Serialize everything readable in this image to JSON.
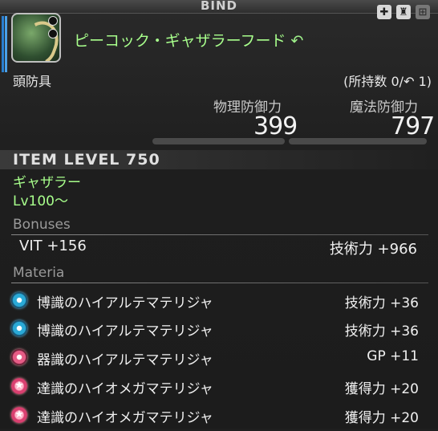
{
  "header": {
    "bind": "BIND"
  },
  "item": {
    "name": "ピーコック・ギャザラーフード",
    "category": "頭防具",
    "owned": "(所持数 0/",
    "owned_suffix": " 1)"
  },
  "stats": [
    {
      "label": "物理防御力",
      "value": "399"
    },
    {
      "label": "魔法防御力",
      "value": "797"
    }
  ],
  "item_level": "ITEM LEVEL 750",
  "class": "ギャザラー",
  "level": "Lv100～",
  "bonuses": {
    "title": "Bonuses",
    "left": "VIT +156",
    "right": "技術力 +966"
  },
  "materia": {
    "title": "Materia",
    "items": [
      {
        "name": "博識のハイアルテマテリジャ",
        "value": "技術力 +36",
        "type": "blue"
      },
      {
        "name": "博識のハイアルテマテリジャ",
        "value": "技術力 +36",
        "type": "blue"
      },
      {
        "name": "器識のハイアルテマテリジャ",
        "value": "GP +11",
        "type": "pink"
      },
      {
        "name": "達識のハイオメガマテリジャ",
        "value": "獲得力 +20",
        "type": "star"
      },
      {
        "name": "達識のハイオメガマテリジャ",
        "value": "獲得力 +20",
        "type": "star"
      }
    ]
  },
  "colors": {
    "accent_green": "#a8ff8c",
    "orb_blue": "#2aa9d6",
    "orb_pink": "#e65c86"
  },
  "icons": [
    "cross-icon",
    "glamour-icon",
    "store-icon",
    "gatherer-symbol-icon"
  ]
}
